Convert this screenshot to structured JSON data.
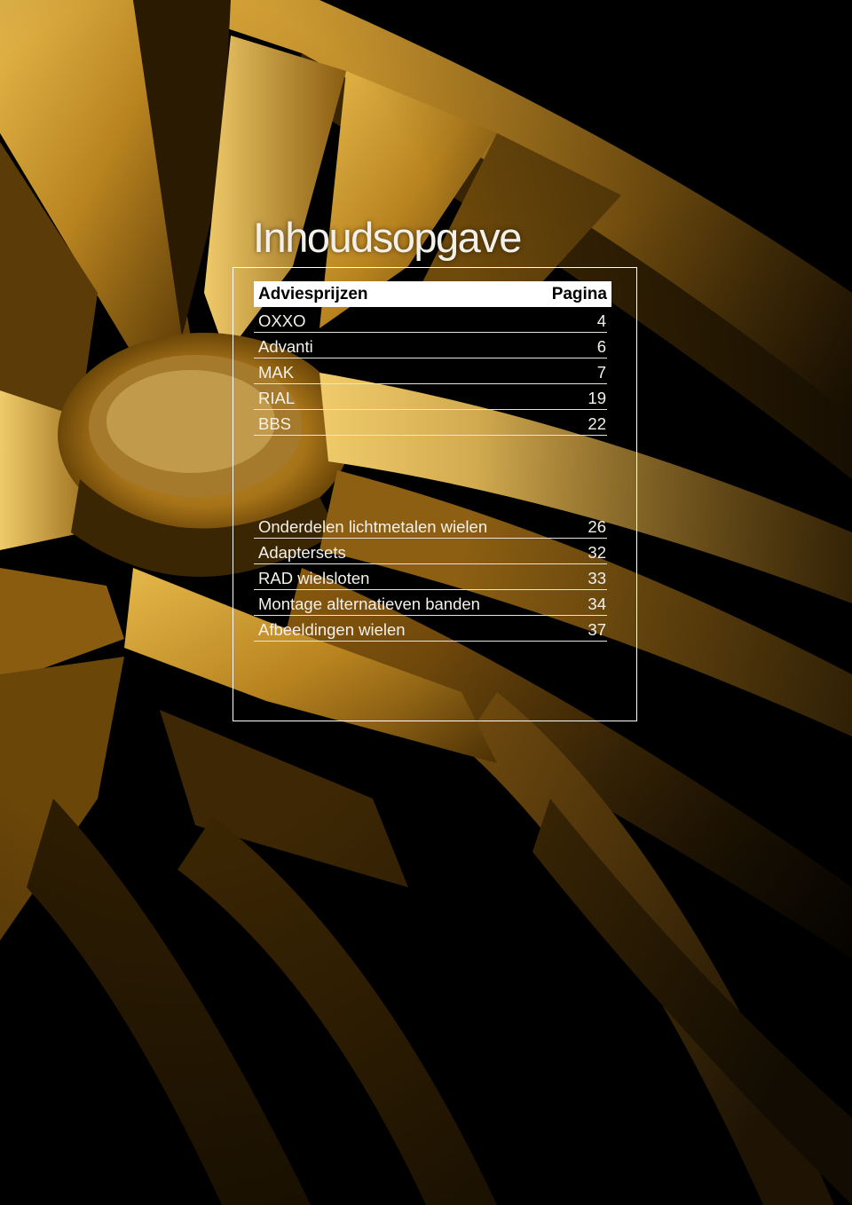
{
  "page": {
    "title": "Inhoudsopgave"
  },
  "toc": {
    "header": {
      "section": "Adviesprijzen",
      "page_column": "Pagina"
    },
    "group1": [
      {
        "label": "OXXO",
        "page": "4"
      },
      {
        "label": "Advanti",
        "page": "6"
      },
      {
        "label": "MAK",
        "page": "7"
      },
      {
        "label": "RIAL",
        "page": "19"
      },
      {
        "label": "BBS",
        "page": "22"
      }
    ],
    "group2": [
      {
        "label": "Onderdelen lichtmetalen wielen",
        "page": "26"
      },
      {
        "label": "Adaptersets",
        "page": "32"
      },
      {
        "label": "RAD wielsloten",
        "page": "33"
      },
      {
        "label": "Montage alternatieven banden",
        "page": "34"
      },
      {
        "label": "Afbeeldingen wielen",
        "page": "37"
      }
    ]
  },
  "colors": {
    "background": "#000000",
    "gold": "#c8922a",
    "text": "#f4f1ea",
    "frame": "#ffffff"
  }
}
